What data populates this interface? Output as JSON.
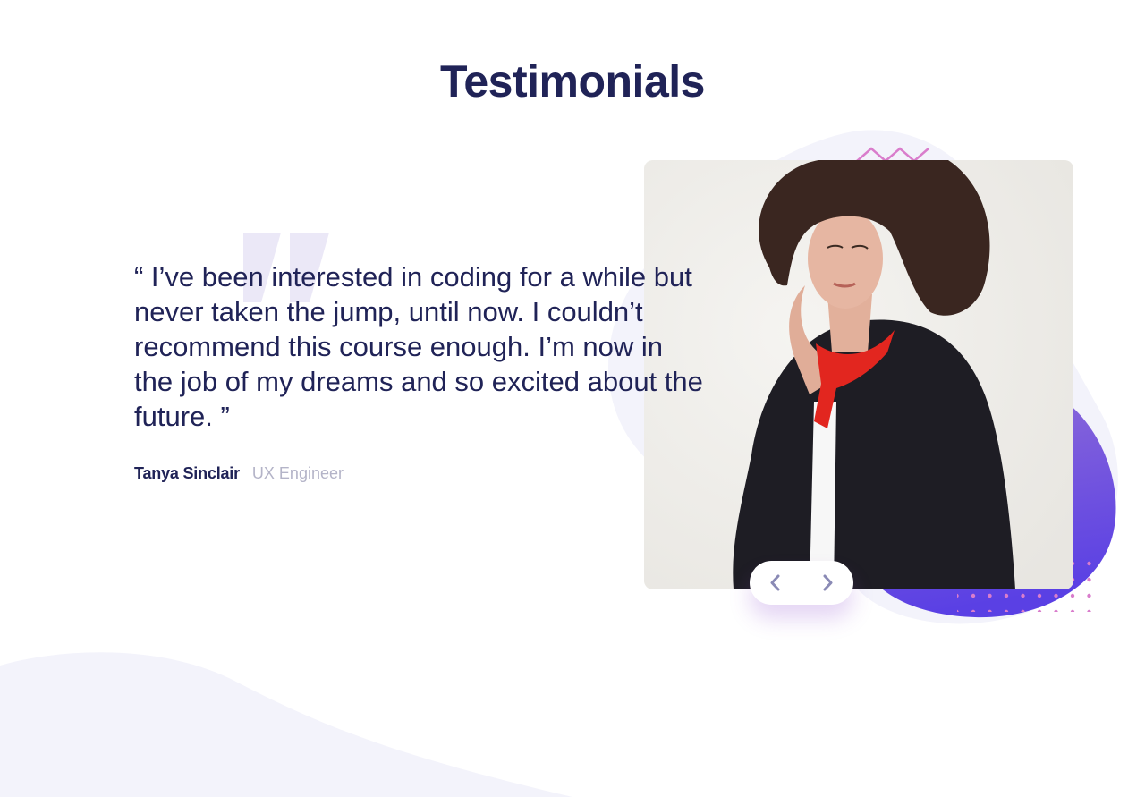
{
  "section": {
    "title": "Testimonials"
  },
  "testimonial": {
    "quote": "“ I’ve been interested in coding for a while but never taken the jump, until now. I couldn’t recommend this course enough. I’m now in the job of my dreams and so excited about the future. ”",
    "author_name": "Tanya Sinclair",
    "author_role": "UX Engineer",
    "photo_alt": "Tanya Sinclair"
  },
  "controls": {
    "prev_icon": "chevron-left-icon",
    "next_icon": "chevron-right-icon"
  },
  "colors": {
    "heading": "#202357",
    "role": "#b4b4c8",
    "accent_purple": "#8746cf",
    "accent_blue": "#5a40e4",
    "wave": "#f3f3fb",
    "pattern_pink": "#d97dcc"
  }
}
